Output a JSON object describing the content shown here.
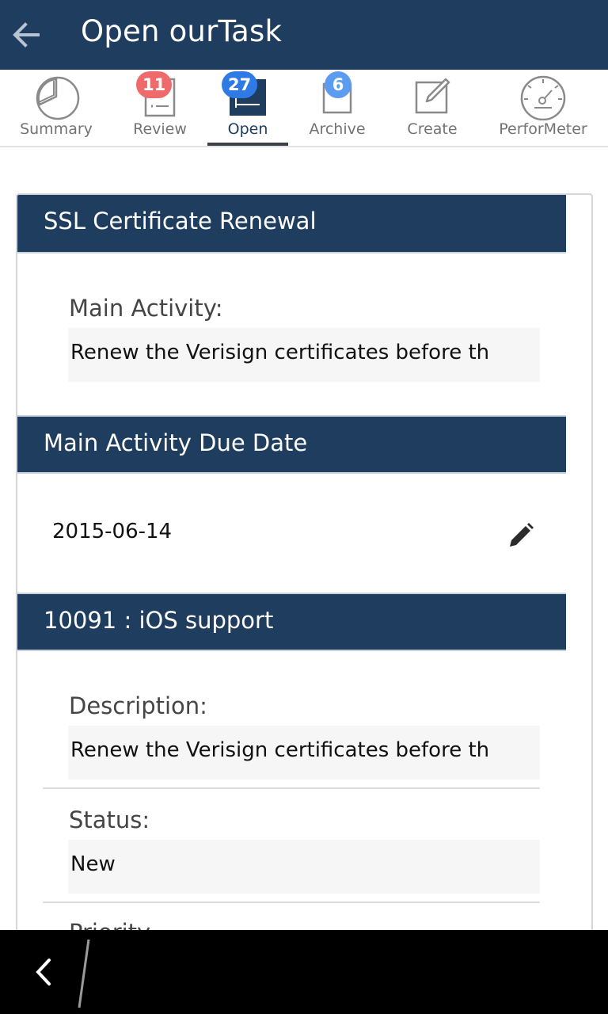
{
  "header": {
    "title": "Open ourTask",
    "back_icon": "arrow-left-icon"
  },
  "tabs": [
    {
      "label": "Summary",
      "icon": "pie-chart-icon",
      "badge": ""
    },
    {
      "label": "Review",
      "icon": "review-card-icon",
      "badge": "11",
      "badge_color": "#ef6a6a"
    },
    {
      "label": "Open",
      "icon": "open-card-icon",
      "badge": "27",
      "badge_color": "#2e7be6",
      "active": true
    },
    {
      "label": "Archive",
      "icon": "archive-box-icon",
      "badge": "6",
      "badge_color": "#5b9cf0"
    },
    {
      "label": "Create",
      "icon": "edit-square-icon",
      "badge": ""
    },
    {
      "label": "PerforMeter",
      "icon": "gauge-icon",
      "badge": ""
    }
  ],
  "task": {
    "title": "SSL Certificate Renewal",
    "main_activity_label": "Main Activity:",
    "main_activity_value": "Renew the Verisign certificates before th"
  },
  "due_date": {
    "header": "Main Activity Due Date",
    "value": "2015-06-14",
    "edit_icon": "pencil-icon"
  },
  "subtask": {
    "header": "10091 : iOS support",
    "description_label": "Description:",
    "description_value": "Renew the Verisign certificates before th",
    "status_label": "Status:",
    "status_value": "New",
    "partial_label": "Priority"
  },
  "colors": {
    "primary": "#1f3d5f",
    "field_bg": "#f6f6f6"
  },
  "system_bar": {
    "back_icon": "chevron-left-icon",
    "slash_icon": "slash-divider-icon"
  }
}
